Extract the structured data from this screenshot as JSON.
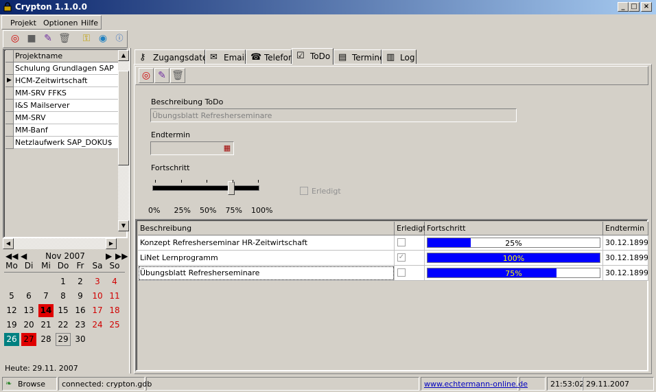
{
  "window": {
    "title": "Crypton 1.1.0.0",
    "min": "_",
    "max": "□",
    "close": "×"
  },
  "menu": {
    "projekt": "Projekt",
    "optionen": "Optionen",
    "hilfe": "Hilfe"
  },
  "projects": {
    "header": "Projektname",
    "items": [
      "Schulung Grundlagen SAP",
      "HCM-Zeitwirtschaft",
      "MM-SRV FFKS",
      "I&S Mailserver",
      "MM-SRV",
      "MM-Banf",
      "Netzlaufwerk SAP_DOKU$"
    ],
    "selected_index": 1
  },
  "calendar": {
    "month": "Nov 2007",
    "weekdays": [
      "Mo",
      "Di",
      "Mi",
      "Do",
      "Fr",
      "Sa",
      "So"
    ],
    "weeks": [
      [
        "",
        "",
        "",
        "1",
        "2",
        "3",
        "4"
      ],
      [
        "5",
        "6",
        "7",
        "8",
        "9",
        "10",
        "11"
      ],
      [
        "12",
        "13",
        "14",
        "15",
        "16",
        "17",
        "18"
      ],
      [
        "19",
        "20",
        "21",
        "22",
        "23",
        "24",
        "25"
      ],
      [
        "26",
        "27",
        "28",
        "29",
        "30",
        "",
        ""
      ]
    ],
    "today_label": "Heute: 29.11. 2007"
  },
  "tabs": [
    {
      "label": "Zugangsdaten",
      "icon": "key-icon"
    },
    {
      "label": "Email",
      "icon": "mail-icon"
    },
    {
      "label": "Telefon",
      "icon": "phone-icon"
    },
    {
      "label": "ToDo",
      "icon": "todo-icon"
    },
    {
      "label": "Termine",
      "icon": "calendar-icon"
    },
    {
      "label": "Log",
      "icon": "log-icon"
    }
  ],
  "active_tab": "ToDo",
  "todo": {
    "beschreibung_label": "Beschreibung ToDo",
    "beschreibung_value": "Übungsblatt Refresherseminare",
    "endtermin_label": "Endtermin",
    "endtermin_value": "",
    "fortschritt_label": "Fortschritt",
    "fortschritt_value": 75,
    "ticks": [
      "0%",
      "25%",
      "50%",
      "75%",
      "100%"
    ],
    "erledigt_label": "Erledigt",
    "erledigt_checked": false
  },
  "grid": {
    "columns": [
      "Beschreibung",
      "Erledigt",
      "Fortschritt",
      "Endtermin"
    ],
    "rows": [
      {
        "beschreibung": "Konzept Refresherseminar HR-Zeitwirtschaft",
        "erledigt": false,
        "fortschritt": 25,
        "fortschritt_label": "25%",
        "endtermin": "30.12.1899"
      },
      {
        "beschreibung": "LiNet Lernprogramm",
        "erledigt": true,
        "fortschritt": 100,
        "fortschritt_label": "100%",
        "endtermin": "30.12.1899"
      },
      {
        "beschreibung": "Übungsblatt Refresherseminare",
        "erledigt": false,
        "fortschritt": 75,
        "fortschritt_label": "75%",
        "endtermin": "30.12.1899"
      }
    ]
  },
  "status": {
    "mode": "Browse",
    "connection": "connected: crypton.gdb",
    "link": "www.echtermann-online.de",
    "time": "21:53:02",
    "date": "29.11.2007"
  },
  "colors": {
    "today": "#e00000",
    "accent_teal": "#008080",
    "progress": "#0000ff"
  }
}
